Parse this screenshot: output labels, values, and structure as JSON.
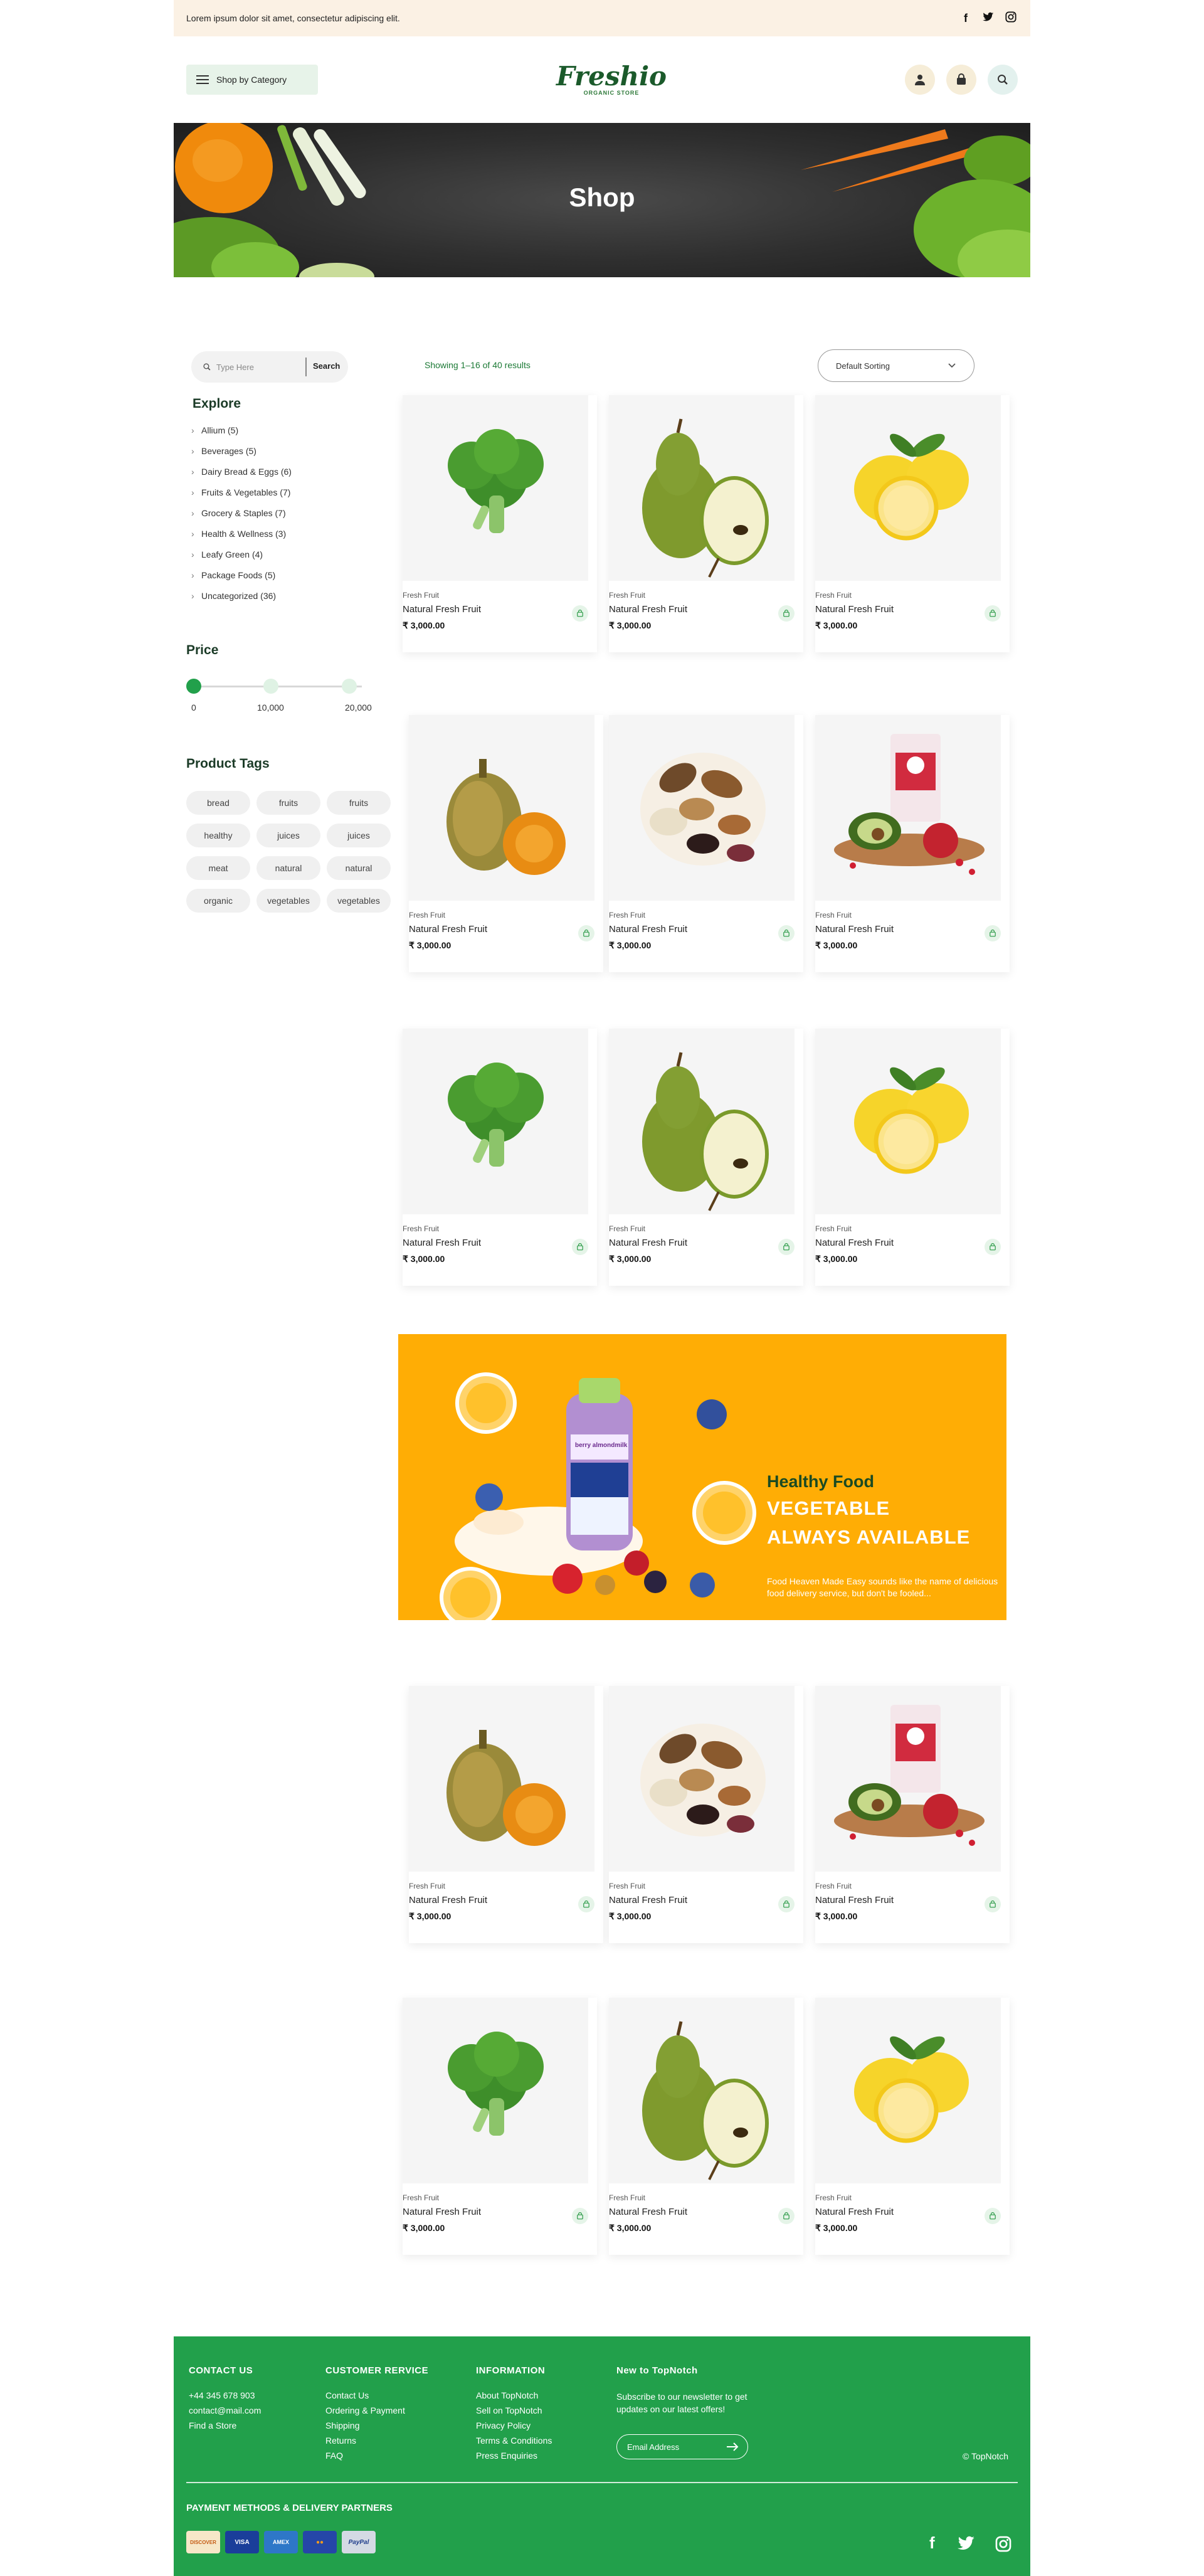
{
  "topbar": {
    "text": "Lorem ipsum dolor sit amet, consectetur adipiscing elit.",
    "social": [
      "f",
      "t",
      "◎"
    ]
  },
  "header": {
    "category_label": "Shop by Category",
    "logo_main": "Freshio",
    "logo_sub": "ORGANIC STORE",
    "icons": [
      "user-icon",
      "bag-icon",
      "search-icon"
    ]
  },
  "hero": {
    "title": "Shop"
  },
  "sidebar": {
    "search_placeholder": "Type Here",
    "search_button": "Search",
    "explore_title": "Explore",
    "categories": [
      "Allium (5)",
      "Beverages (5)",
      "Dairy Bread & Eggs (6)",
      "Fruits & Vegetables (7)",
      "Grocery & Staples (7)",
      "Health & Wellness (3)",
      "Leafy Green (4)",
      "Package Foods (5)",
      "Uncategorized (36)"
    ],
    "price_title": "Price",
    "price_labels": [
      "0",
      "10,000",
      "20,000"
    ],
    "price_selected_fraction": 0,
    "tags_title": "Product Tags",
    "tags": [
      "bread",
      "fruits",
      "fruits",
      "healthy",
      "juices",
      "juices",
      "meat",
      "natural",
      "natural",
      "organic",
      "vegetables",
      "vegetables"
    ]
  },
  "toolbar": {
    "results_text": "Showing 1–16 of 40 results",
    "sort_label": "Default Sorting"
  },
  "products": [
    {
      "category": "Fresh Fruit",
      "name": "Natural Fresh Fruit",
      "price": "₹ 3,000.00",
      "image": "broccoli"
    },
    {
      "category": "Fresh Fruit",
      "name": "Natural Fresh Fruit",
      "price": "₹ 3,000.00",
      "image": "pear"
    },
    {
      "category": "Fresh Fruit",
      "name": "Natural Fresh Fruit",
      "price": "₹ 3,000.00",
      "image": "lemon"
    },
    {
      "category": "Fresh Fruit",
      "name": "Natural Fresh Fruit",
      "price": "₹ 3,000.00",
      "image": "squash"
    },
    {
      "category": "Fresh Fruit",
      "name": "Natural Fresh Fruit",
      "price": "₹ 3,000.00",
      "image": "nuts"
    },
    {
      "category": "Fresh Fruit",
      "name": "Natural Fresh Fruit",
      "price": "₹ 3,000.00",
      "image": "pomegranate-drink"
    },
    {
      "category": "Fresh Fruit",
      "name": "Natural Fresh Fruit",
      "price": "₹ 3,000.00",
      "image": "broccoli"
    },
    {
      "category": "Fresh Fruit",
      "name": "Natural Fresh Fruit",
      "price": "₹ 3,000.00",
      "image": "pear"
    },
    {
      "category": "Fresh Fruit",
      "name": "Natural Fresh Fruit",
      "price": "₹ 3,000.00",
      "image": "lemon"
    },
    {
      "category": "Fresh Fruit",
      "name": "Natural Fresh Fruit",
      "price": "₹ 3,000.00",
      "image": "squash"
    },
    {
      "category": "Fresh Fruit",
      "name": "Natural Fresh Fruit",
      "price": "₹ 3,000.00",
      "image": "nuts"
    },
    {
      "category": "Fresh Fruit",
      "name": "Natural Fresh Fruit",
      "price": "₹ 3,000.00",
      "image": "pomegranate-drink"
    },
    {
      "category": "Fresh Fruit",
      "name": "Natural Fresh Fruit",
      "price": "₹ 3,000.00",
      "image": "broccoli"
    },
    {
      "category": "Fresh Fruit",
      "name": "Natural Fresh Fruit",
      "price": "₹ 3,000.00",
      "image": "pear"
    },
    {
      "category": "Fresh Fruit",
      "name": "Natural Fresh Fruit",
      "price": "₹ 3,000.00",
      "image": "lemon"
    }
  ],
  "banner": {
    "kicker": "Healthy Food",
    "line1": "VEGETABLE",
    "line2": "ALWAYS AVAILABLE",
    "body": "Food Heaven Made Easy sounds like the name of delicious food delivery service, but don't be fooled...",
    "bottle_label": "berry almondmilk"
  },
  "footer": {
    "contact_title": "CONTACT US",
    "contact_items": [
      "+44 345 678 903",
      "contact@mail.com",
      "Find a Store"
    ],
    "service_title": "CUSTOMER RERVICE",
    "service_items": [
      "Contact Us",
      "Ordering & Payment",
      "Shipping",
      "Returns",
      "FAQ"
    ],
    "info_title": "INFORMATION",
    "info_items": [
      "About TopNotch",
      "Sell on TopNotch",
      "Privacy Policy",
      "Terms & Conditions",
      "Press Enquiries"
    ],
    "news_title": "New to TopNotch",
    "news_text": "Subscribe to our newsletter to get updates on our latest offers!",
    "email_placeholder": "Email Address",
    "copyright": "© TopNotch",
    "payment_title": "PAYMENT METHODS & DELIVERY PARTNERS",
    "payment_methods": [
      "DISCOVER",
      "VISA",
      "AMEX",
      "●●",
      "PayPal"
    ],
    "social": [
      "f",
      "t",
      "◎"
    ]
  },
  "colors": {
    "brand_green": "#22a04b",
    "banner_orange": "#ffad05",
    "topbar_cream": "#fbf1e4",
    "dark_green": "#1b3b27"
  }
}
